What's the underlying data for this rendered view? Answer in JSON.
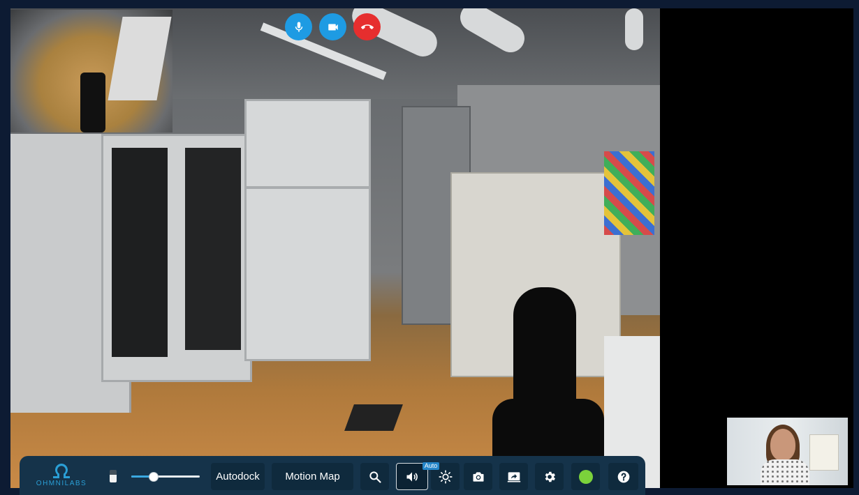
{
  "call_controls": {
    "mic": {
      "icon": "microphone-icon",
      "color": "#1e9be3"
    },
    "camera": {
      "icon": "video-camera-icon",
      "color": "#1e9be3"
    },
    "hangup": {
      "icon": "phone-hangup-icon",
      "color": "#e62e2e"
    }
  },
  "toolbar": {
    "logo_text": "OHMNILABS",
    "battery_icon": "battery-icon",
    "speed_slider": {
      "value_fraction": 0.32
    },
    "autodock_label": "Autodock",
    "motion_map_label": "Motion Map",
    "zoom_icon": "search-icon",
    "audio_icon": "speaker-icon",
    "brightness_icon": "brightness-icon",
    "brightness_badge": "Auto",
    "snapshot_icon": "camera-icon",
    "share_screen_icon": "share-screen-icon",
    "settings_icon": "gear-icon",
    "status_color": "#7bd23b",
    "help_icon": "help-icon"
  },
  "colors": {
    "page_bg": "#0d1b33",
    "toolbar_bg": "#15334a",
    "button_bg": "#0f2a3d",
    "accent": "#2a9fd6"
  }
}
